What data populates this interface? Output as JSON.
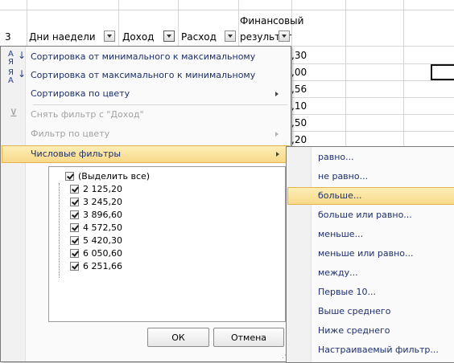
{
  "row_number": "3",
  "headers": {
    "days": "Дни наедели",
    "income": "Доход",
    "expense": "Расход",
    "result_line1": "Финансовый",
    "result_line2": "результат"
  },
  "visible_cells": [
    ",30",
    ",00",
    ",56",
    ",10",
    ",50",
    ",20"
  ],
  "menu": {
    "sort_asc": "Сортировка от минимального к максимальному",
    "sort_desc": "Сортировка от максимального к минимальному",
    "sort_by_color": "Сортировка по цвету",
    "clear_filter": "Снять фильтр с \"Доход\"",
    "filter_by_color": "Фильтр по цвету",
    "number_filters": "Числовые фильтры"
  },
  "values_list": {
    "select_all": "(Выделить все)",
    "items": [
      "2 125,20",
      "3 245,20",
      "3 896,60",
      "4 572,50",
      "5 420,30",
      "6 050,60",
      "6 251,66"
    ]
  },
  "buttons": {
    "ok": "ОК",
    "cancel": "Отмена"
  },
  "submenu": {
    "items": [
      "равно...",
      "не равно...",
      "больше...",
      "больше или равно...",
      "меньше...",
      "меньше или равно...",
      "между...",
      "Первые 10...",
      "Выше среднего",
      "Ниже среднего",
      "Настраиваемый фильтр..."
    ],
    "highlighted": "больше..."
  },
  "colors": {
    "highlight": "#f8d98a",
    "menu_text": "#1c2f6b",
    "disabled_text": "#a2a2a2"
  }
}
